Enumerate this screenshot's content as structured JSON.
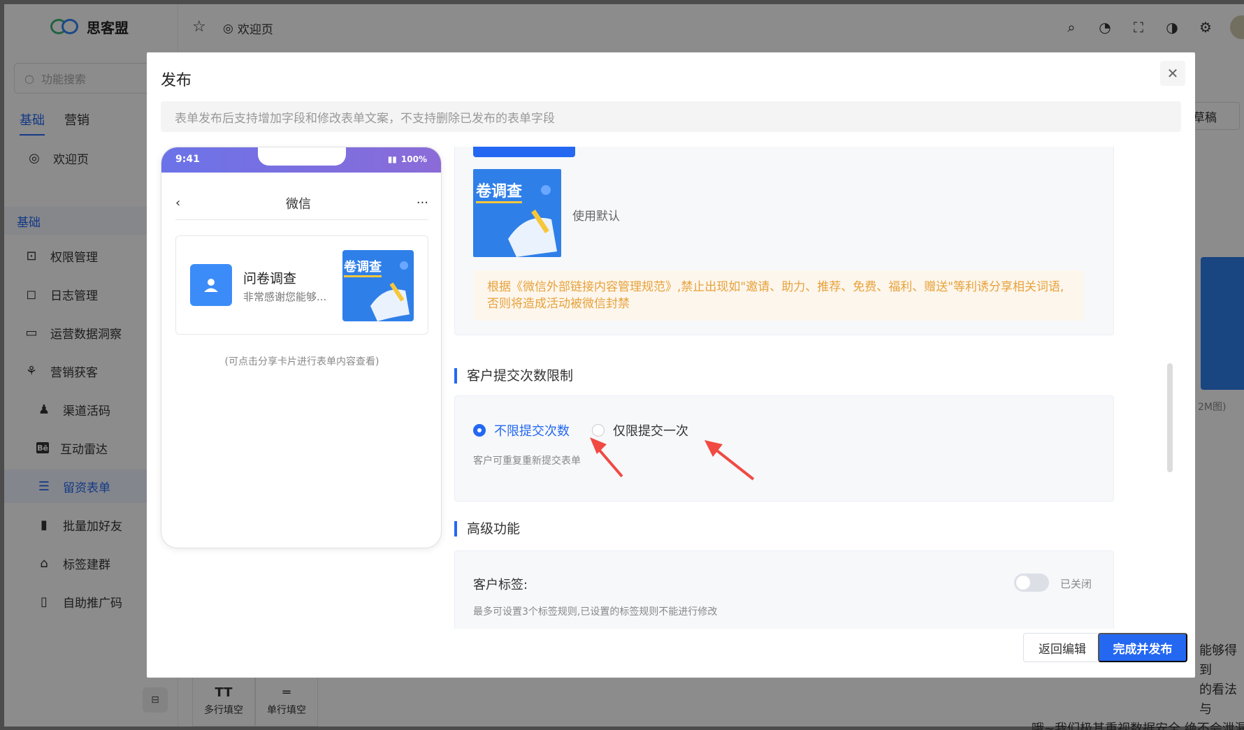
{
  "brand": {
    "name": "思客盟"
  },
  "topbar": {
    "crumb_label": "欢迎页"
  },
  "sidebar": {
    "search_placeholder": "功能搜索",
    "tabs": [
      "基础",
      "营销"
    ],
    "welcome_label": "欢迎页",
    "section_label": "基础",
    "items": [
      {
        "label": "权限管理",
        "icon": "lock-icon"
      },
      {
        "label": "日志管理",
        "icon": "instagram-icon"
      },
      {
        "label": "运营数据洞察",
        "icon": "monitor-icon"
      },
      {
        "label": "营销获客",
        "icon": "acquire-icon"
      },
      {
        "label": "渠道活码",
        "icon": "user-icon"
      },
      {
        "label": "互动雷达",
        "icon": "behance-icon"
      },
      {
        "label": "留资表单",
        "icon": "list-icon"
      },
      {
        "label": "批量加好友",
        "icon": "clipboard-icon"
      },
      {
        "label": "标签建群",
        "icon": "bank-icon"
      },
      {
        "label": "自助推广码",
        "icon": "book-icon"
      }
    ]
  },
  "background": {
    "tools": [
      {
        "icon_text": "TT",
        "label": "多行填空"
      },
      {
        "icon_text": "═",
        "label": "单行填空"
      }
    ],
    "draft_label": "草稿",
    "image_hint": "2M图)",
    "text_lines": [
      "能够得到",
      "的看法与",
      "哦~我们极其重视数据安全,绝不会泄漏"
    ]
  },
  "modal": {
    "title": "发布",
    "notice": "表单发布后支持增加字段和修改表单文案，不支持删除已发布的表单字段",
    "phone": {
      "time": "9:41",
      "battery": "100%",
      "nav_title": "微信",
      "card_title": "问卷调查",
      "card_desc": "非常感谢您能够...",
      "thumb_text": "卷调查",
      "hint": "(可点击分享卡片进行表单内容查看)"
    },
    "cover": {
      "thumb_text": "卷调查",
      "default_label": "使用默认",
      "warning": "根据《微信外部链接内容管理规范》,禁止出现如\"邀请、助力、推荐、免费、福利、赠送\"等利诱分享相关词语,否则将造成活动被微信封禁"
    },
    "submit_limit": {
      "section_title": "客户提交次数限制",
      "options": [
        "不限提交次数",
        "仅限提交一次"
      ],
      "selected": "不限提交次数",
      "hint": "客户可重复重新提交表单"
    },
    "advanced": {
      "section_title": "高级功能",
      "tag_label": "客户标签:",
      "tag_state": "已关闭",
      "tag_enabled": false,
      "tag_hint": "最多可设置3个标签规则,已设置的标签规则不能进行修改"
    },
    "buttons": {
      "back": "返回编辑",
      "publish": "完成并发布"
    }
  },
  "colors": {
    "primary": "#2468f2",
    "warning_bg": "#fdf6ec",
    "warning_text": "#e6a23c",
    "arrow": "#f04a43"
  }
}
